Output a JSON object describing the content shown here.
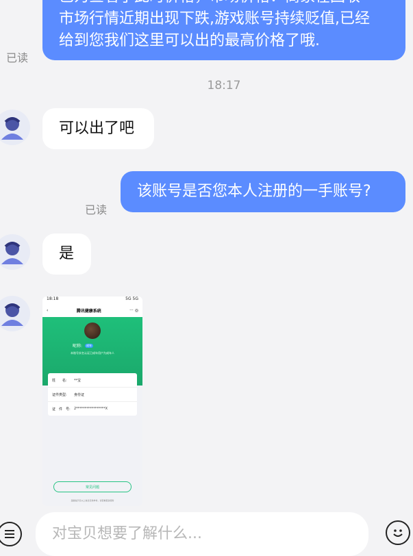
{
  "conversation": {
    "msg1": {
      "line1": "已为查看了此时价格，市场价格：商家在回收时，是否",
      "line2": "市场行情近期出现下跌,游戏账号持续贬值,已经",
      "line3": "给到您我们这里可以出的最高价格了哦.",
      "read": "已读"
    },
    "timestamp": "18:17",
    "msg2": {
      "text": "可以出了吧"
    },
    "msg3": {
      "text": "该账号是否您本人注册的一手账号?",
      "read": "已读"
    },
    "msg4": {
      "text": "是"
    },
    "image_msg": {
      "status_time": "18:18",
      "status_right": "5G 5G",
      "nav_title": "腾讯健康系统",
      "nickname_label": "昵称:",
      "badge": "成年",
      "note": "本账号实名认证已成年用户为成年人",
      "rows": [
        {
          "label": "姓　　名:",
          "value": "**宝"
        },
        {
          "label": "证件类型:",
          "value": "身份证"
        },
        {
          "label": "证　件　号:",
          "value": "2*****************X"
        }
      ],
      "button": "常见问题",
      "footer": "温馨提示仅以上信息仅供参考，请查看更多服务"
    }
  },
  "composer": {
    "placeholder": "对宝贝想要了解什么..."
  }
}
